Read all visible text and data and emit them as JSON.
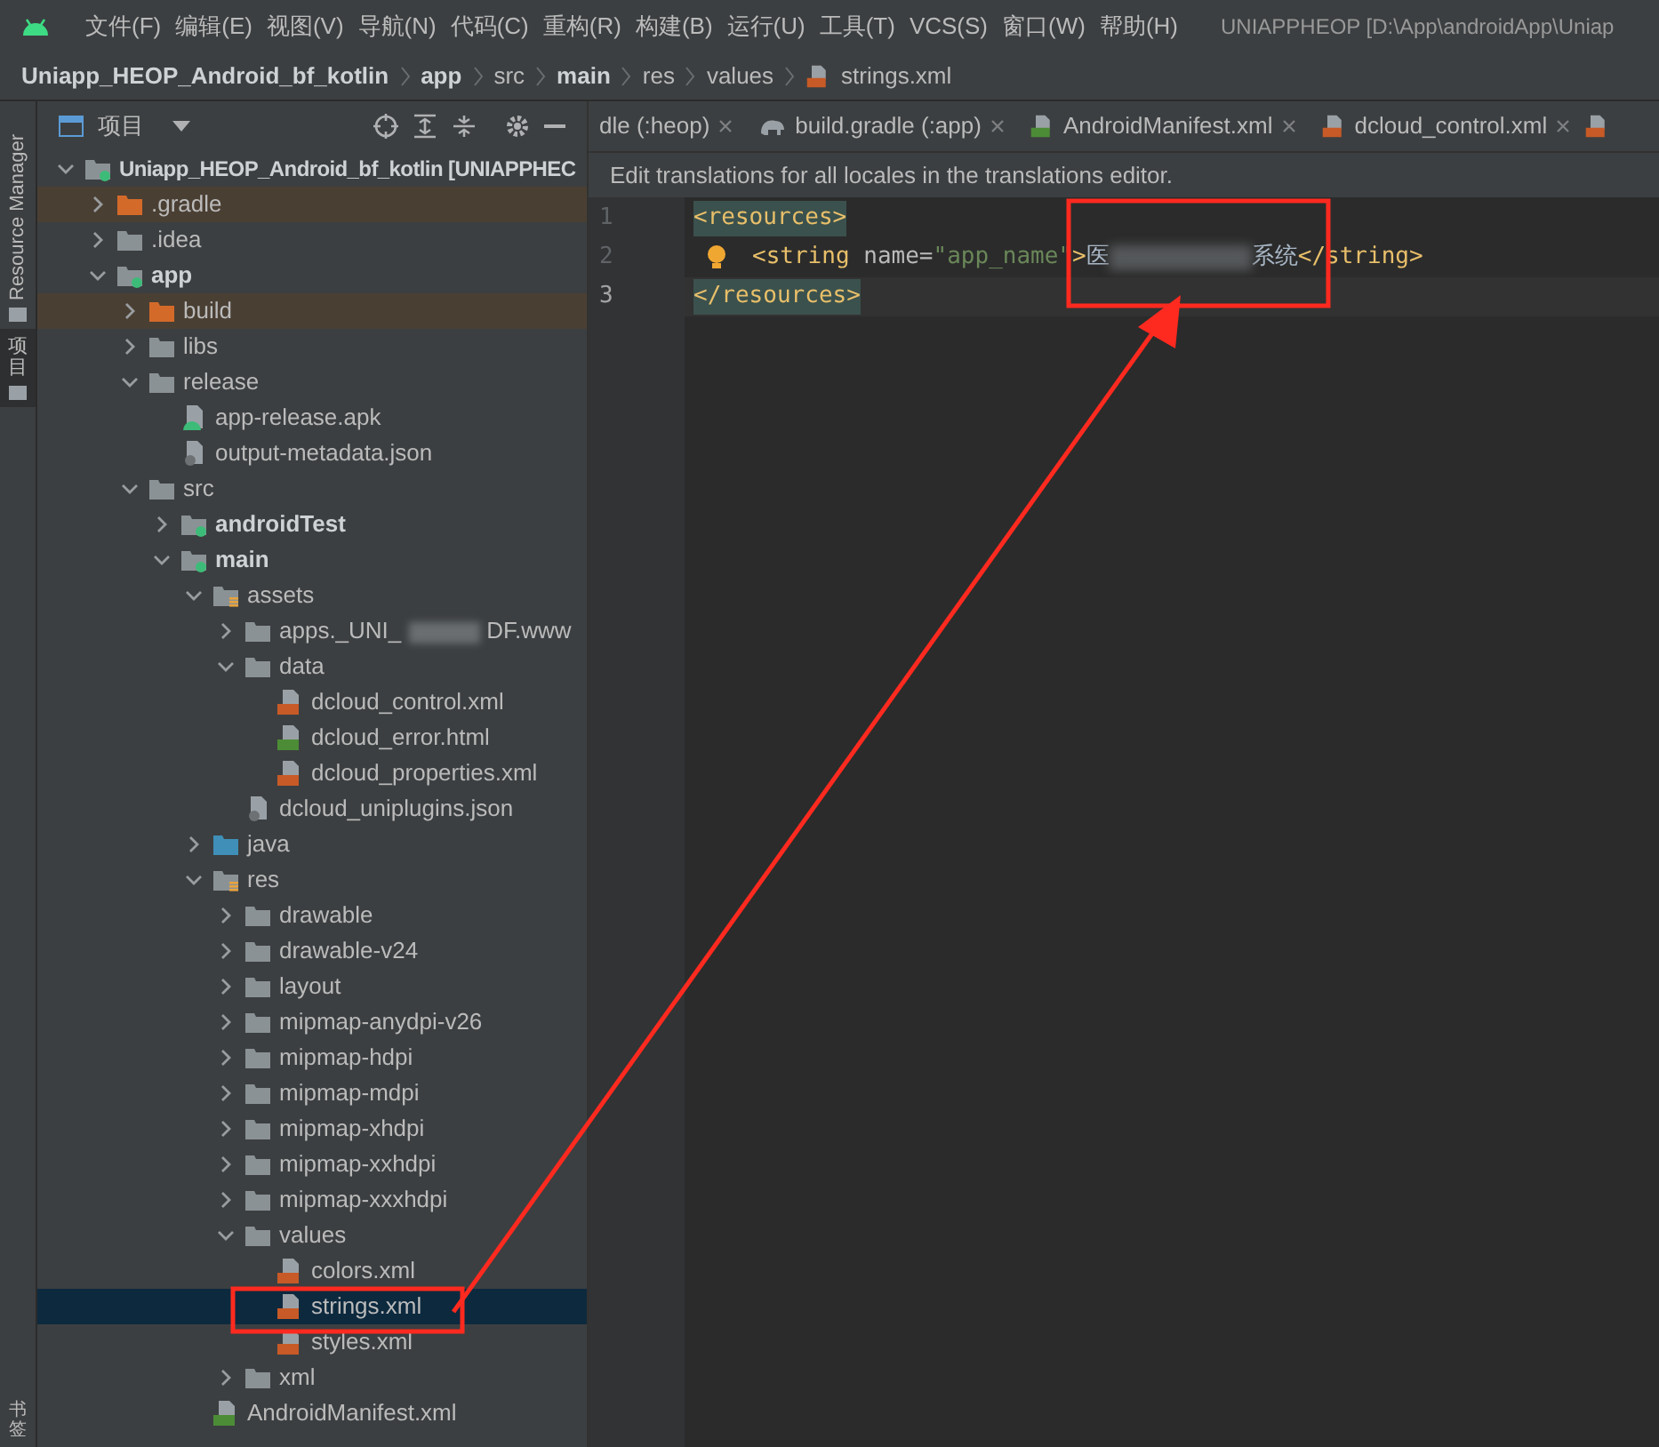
{
  "menu_bar": {
    "items": [
      "文件(F)",
      "编辑(E)",
      "视图(V)",
      "导航(N)",
      "代码(C)",
      "重构(R)",
      "构建(B)",
      "运行(U)",
      "工具(T)",
      "VCS(S)",
      "窗口(W)",
      "帮助(H)"
    ],
    "title": "UNIAPPHEOP [D:\\App\\androidApp\\Uniap"
  },
  "breadcrumb": [
    {
      "label": "Uniapp_HEOP_Android_bf_kotlin",
      "bold": true
    },
    {
      "label": "app",
      "bold": true
    },
    {
      "label": "src",
      "bold": false
    },
    {
      "label": "main",
      "bold": true
    },
    {
      "label": "res",
      "bold": false
    },
    {
      "label": "values",
      "bold": false
    },
    {
      "label": "strings.xml",
      "bold": false,
      "kind": "xml"
    }
  ],
  "side_strip": {
    "top_tabs": [
      {
        "label": "Resource Manager",
        "kind": "rotated",
        "selected": false
      },
      {
        "label": "项目",
        "kind": "cjk",
        "selected": true
      }
    ],
    "bottom_tabs": [
      {
        "label": "书签",
        "kind": "cjk",
        "selected": false
      }
    ]
  },
  "project_panel": {
    "title": "项目",
    "tree": [
      {
        "label": "Uniapp_HEOP_Android_bf_kotlin **[UNIAPPHEC**",
        "kind": "module-root",
        "expanded": true,
        "selected": false,
        "excluded": false,
        "children": [
          {
            "label": ".gradle",
            "kind": "folder-orange",
            "expanded": false,
            "selected": false,
            "excluded": true
          },
          {
            "label": ".idea",
            "kind": "folder",
            "expanded": false,
            "selected": false,
            "excluded": false
          },
          {
            "label": "app",
            "kind": "module",
            "expanded": true,
            "selected": false,
            "excluded": false,
            "children": [
              {
                "label": "build",
                "kind": "folder-orange",
                "expanded": false,
                "selected": false,
                "excluded": true
              },
              {
                "label": "libs",
                "kind": "folder",
                "expanded": false,
                "selected": false,
                "excluded": false
              },
              {
                "label": "release",
                "kind": "folder",
                "expanded": true,
                "selected": false,
                "excluded": false,
                "children": [
                  {
                    "label": "app-release.apk",
                    "kind": "file-apk",
                    "selected": false,
                    "excluded": false
                  },
                  {
                    "label": "output-metadata.json",
                    "kind": "file-json",
                    "selected": false,
                    "excluded": false
                  }
                ]
              },
              {
                "label": "src",
                "kind": "folder",
                "expanded": true,
                "selected": false,
                "excluded": false,
                "children": [
                  {
                    "label": "androidTest",
                    "kind": "module",
                    "expanded": false,
                    "selected": false,
                    "excluded": false
                  },
                  {
                    "label": "main",
                    "kind": "module",
                    "expanded": true,
                    "selected": false,
                    "excluded": false,
                    "children": [
                      {
                        "label": "assets",
                        "kind": "res-folder",
                        "expanded": true,
                        "selected": false,
                        "excluded": false,
                        "children": [
                          {
                            "label": "apps._UNI_",
                            "label_end": "DF.www",
                            "kind": "folder",
                            "expanded": false,
                            "selected": false,
                            "excluded": false
                          },
                          {
                            "label": "data",
                            "kind": "folder",
                            "expanded": true,
                            "selected": false,
                            "excluded": false,
                            "children": [
                              {
                                "label": "dcloud_control.xml",
                                "kind": "file-xml",
                                "selected": false,
                                "excluded": false
                              },
                              {
                                "label": "dcloud_error.html",
                                "kind": "file-html",
                                "selected": false,
                                "excluded": false
                              },
                              {
                                "label": "dcloud_properties.xml",
                                "kind": "file-xml",
                                "selected": false,
                                "excluded": false
                              }
                            ]
                          },
                          {
                            "label": "dcloud_uniplugins.json",
                            "kind": "file-json",
                            "selected": false,
                            "excluded": false
                          }
                        ]
                      },
                      {
                        "label": "java",
                        "kind": "folder-blue",
                        "expanded": false,
                        "selected": false,
                        "excluded": false
                      },
                      {
                        "label": "res",
                        "kind": "res-folder",
                        "expanded": true,
                        "selected": false,
                        "excluded": false,
                        "children": [
                          {
                            "label": "drawable",
                            "kind": "folder",
                            "expanded": false,
                            "selected": false,
                            "excluded": false
                          },
                          {
                            "label": "drawable-v24",
                            "kind": "folder",
                            "expanded": false,
                            "selected": false,
                            "excluded": false
                          },
                          {
                            "label": "layout",
                            "kind": "folder",
                            "expanded": false,
                            "selected": false,
                            "excluded": false
                          },
                          {
                            "label": "mipmap-anydpi-v26",
                            "kind": "folder",
                            "expanded": false,
                            "selected": false,
                            "excluded": false
                          },
                          {
                            "label": "mipmap-hdpi",
                            "kind": "folder",
                            "expanded": false,
                            "selected": false,
                            "excluded": false
                          },
                          {
                            "label": "mipmap-mdpi",
                            "kind": "folder",
                            "expanded": false,
                            "selected": false,
                            "excluded": false
                          },
                          {
                            "label": "mipmap-xhdpi",
                            "kind": "folder",
                            "expanded": false,
                            "selected": false,
                            "excluded": false
                          },
                          {
                            "label": "mipmap-xxhdpi",
                            "kind": "folder",
                            "expanded": false,
                            "selected": false,
                            "excluded": false
                          },
                          {
                            "label": "mipmap-xxxhdpi",
                            "kind": "folder",
                            "expanded": false,
                            "selected": false,
                            "excluded": false
                          },
                          {
                            "label": "values",
                            "kind": "folder",
                            "expanded": true,
                            "selected": false,
                            "excluded": false,
                            "children": [
                              {
                                "label": "colors.xml",
                                "kind": "file-xml",
                                "selected": false,
                                "excluded": false
                              },
                              {
                                "label": "strings.xml",
                                "kind": "file-xml",
                                "selected": true,
                                "excluded": false
                              },
                              {
                                "label": "styles.xml",
                                "kind": "file-xml",
                                "selected": false,
                                "excluded": false
                              }
                            ]
                          },
                          {
                            "label": "xml",
                            "kind": "folder",
                            "expanded": false,
                            "selected": false,
                            "excluded": false
                          }
                        ]
                      },
                      {
                        "label": "AndroidManifest.xml",
                        "kind": "file-manifest",
                        "selected": false,
                        "excluded": false
                      }
                    ]
                  }
                ]
              }
            ]
          }
        ]
      }
    ]
  },
  "editor_tabs": [
    {
      "label": "dle (:heop)",
      "kind": "none"
    },
    {
      "label": "build.gradle (:app)",
      "kind": "gradle"
    },
    {
      "label": "AndroidManifest.xml",
      "kind": "manifest"
    },
    {
      "label": "dcloud_control.xml",
      "kind": "xml"
    }
  ],
  "editor": {
    "banner": "Edit translations for all locales in the translations editor.",
    "lines": [
      {
        "number": "1",
        "current": false,
        "bulb": false,
        "segments": [
          {
            "kind": "tag",
            "text": "<resources>"
          }
        ]
      },
      {
        "number": "2",
        "current": false,
        "bulb": true,
        "segments": [
          {
            "kind": "indent"
          },
          {
            "kind": "tag",
            "text": "<string "
          },
          {
            "kind": "attr",
            "text": "name="
          },
          {
            "kind": "value",
            "text": "\"app_name\""
          },
          {
            "kind": "tag",
            "text": ">"
          },
          {
            "kind": "text",
            "text": "医"
          },
          {
            "kind": "blur"
          },
          {
            "kind": "text",
            "text": "系统"
          },
          {
            "kind": "tag",
            "text": "</string>"
          }
        ]
      },
      {
        "number": "3",
        "current": true,
        "bulb": false,
        "segments": [
          {
            "kind": "tag",
            "text": "</resources>"
          }
        ]
      }
    ]
  }
}
